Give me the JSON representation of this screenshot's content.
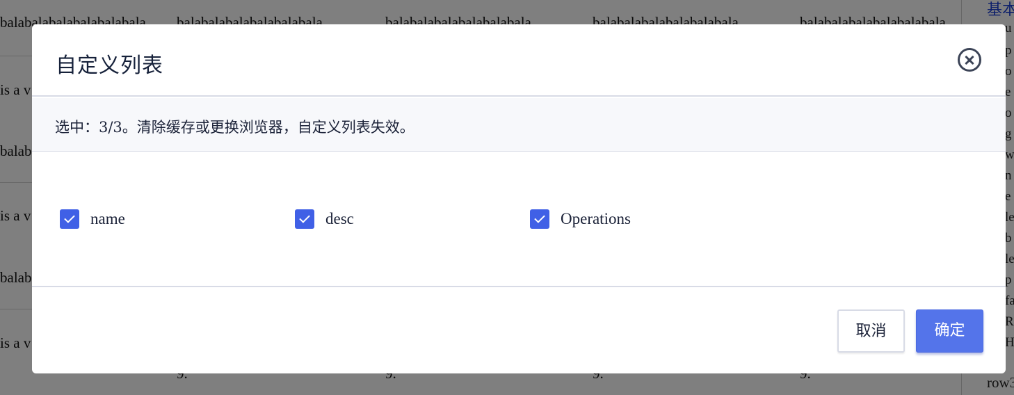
{
  "background": {
    "header_cells": [
      "balabalabalabalabalabala",
      "balabalabalabalabalabala",
      "balabalabalabalabalabala",
      "balabalabalabalabalabala",
      "balabalabalabalabalabala"
    ],
    "row_text_a": "is a v",
    "row_text_b": "balab",
    "bottom_cell": "9.",
    "side_link": "基本",
    "side_fragments": [
      "u",
      "p",
      "o",
      "e",
      "o",
      "g",
      "w",
      "n",
      "e",
      "le",
      "b",
      "le",
      "p",
      "fa",
      "R",
      "H"
    ],
    "side_row_label": "row3"
  },
  "modal": {
    "title": "自定义列表",
    "info": "选中：3/3。清除缓存或更换浏览器，自定义列表失效。",
    "options": [
      {
        "label": "name",
        "checked": true
      },
      {
        "label": "desc",
        "checked": true
      },
      {
        "label": "Operations",
        "checked": true
      }
    ],
    "cancel_label": "取消",
    "confirm_label": "确定"
  },
  "colors": {
    "accent": "#4060e6",
    "confirm": "#5474ea",
    "overlay": "rgba(0,0,0,0.5)"
  }
}
